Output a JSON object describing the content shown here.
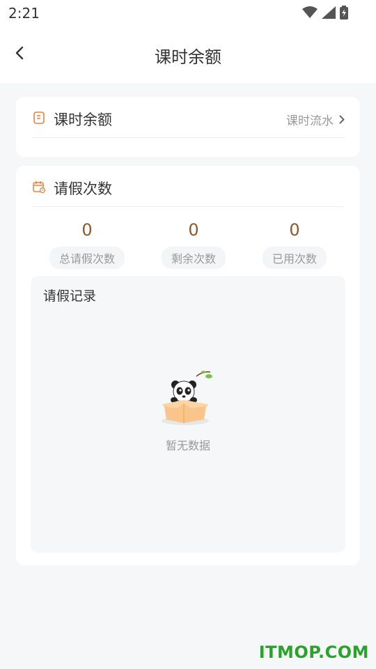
{
  "status": {
    "time": "2:21"
  },
  "nav": {
    "title": "课时余额"
  },
  "balance_card": {
    "title": "课时余额",
    "link": "课时流水"
  },
  "leave_card": {
    "title": "请假次数",
    "stats": [
      {
        "value": "0",
        "label": "总请假次数"
      },
      {
        "value": "0",
        "label": "剩余次数"
      },
      {
        "value": "0",
        "label": "已用次数"
      }
    ],
    "records_title": "请假记录",
    "empty_text": "暂无数据"
  },
  "watermark": "ITMOP.COM",
  "colors": {
    "accent": "#e8833a",
    "value": "#8a5a2b",
    "watermark": "#2aa32a"
  },
  "icons": [
    "wifi-icon",
    "signal-icon",
    "battery-icon",
    "back-arrow-icon",
    "notebook-icon",
    "calendar-icon",
    "chevron-right-icon",
    "panda-box-illustration"
  ]
}
